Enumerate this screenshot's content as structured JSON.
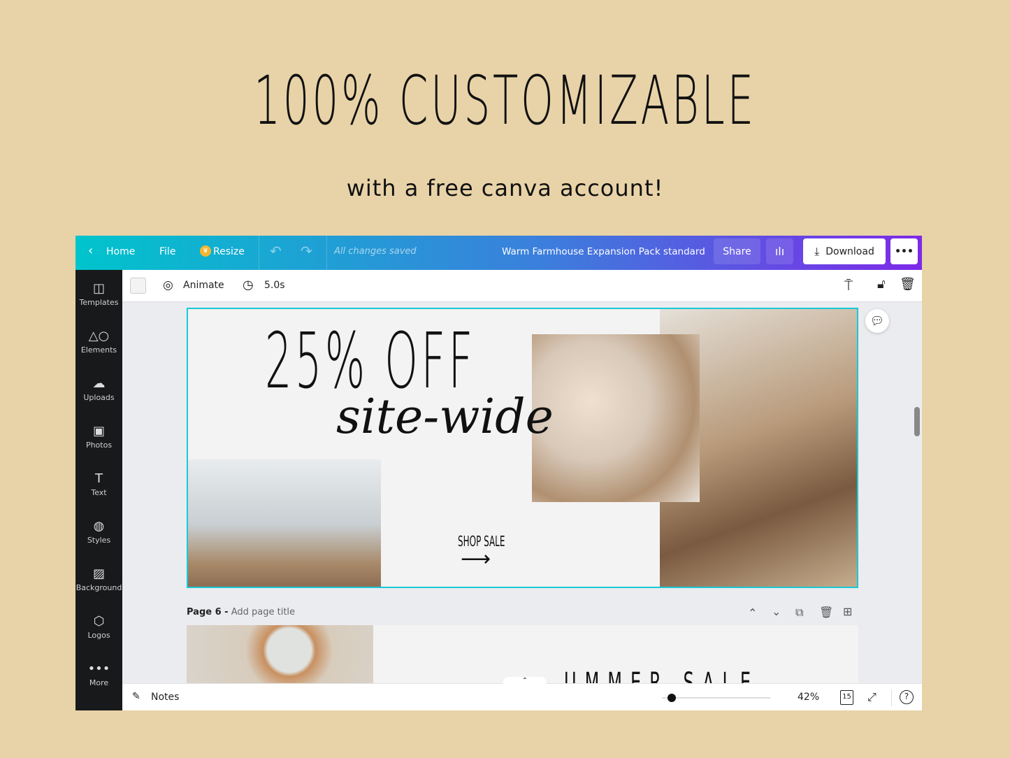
{
  "promo": {
    "title": "100% CUSTOMIZABLE",
    "subtitle": "with a free canva account!"
  },
  "header": {
    "home": "Home",
    "file": "File",
    "resize": "Resize",
    "status": "All changes saved",
    "doc_title": "Warm Farmhouse Expansion Pack standard",
    "share": "Share",
    "download": "Download",
    "more": "•••",
    "colors": {
      "gradient_start": "#00c4cc",
      "gradient_end": "#7d2ae8"
    }
  },
  "sidebar": {
    "items": [
      {
        "label": "Templates",
        "icon": "templates-icon"
      },
      {
        "label": "Elements",
        "icon": "elements-icon"
      },
      {
        "label": "Uploads",
        "icon": "upload-cloud-icon"
      },
      {
        "label": "Photos",
        "icon": "photo-icon"
      },
      {
        "label": "Text",
        "icon": "text-icon"
      },
      {
        "label": "Styles",
        "icon": "palette-icon"
      },
      {
        "label": "Background",
        "icon": "background-icon"
      },
      {
        "label": "Logos",
        "icon": "logo-icon"
      },
      {
        "label": "More",
        "icon": "more-icon"
      }
    ]
  },
  "toolbar": {
    "animate": "Animate",
    "duration": "5.0s"
  },
  "design": {
    "headline": "25% OFF",
    "script": "site-wide",
    "cta": "SHOP SALE"
  },
  "page6": {
    "label": "Page 6 -",
    "placeholder": "Add page title",
    "peek_text": "UMMER SALE"
  },
  "bottom": {
    "notes": "Notes",
    "zoom": "42%",
    "zoom_fraction": 0.05,
    "pages": "15"
  }
}
